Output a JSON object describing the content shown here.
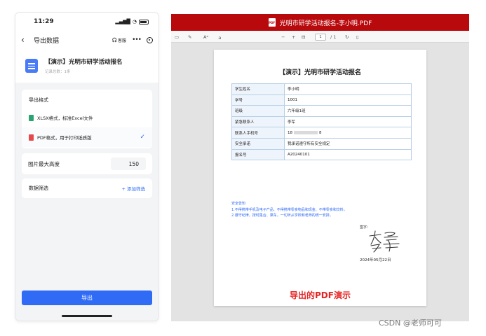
{
  "phone": {
    "time": "11:29",
    "nav": {
      "back_icon": "chevron-left-icon",
      "title": "导出数据",
      "service": "客服"
    },
    "document": {
      "icon": "document-icon",
      "title": "【演示】光明市研学活动报名",
      "subtitle": "记录总数：1条"
    },
    "format": {
      "label": "导出格式",
      "options": [
        {
          "icon": "xlsx-file-icon",
          "color": "#2ba471",
          "text": "XLSX格式，标准Excel文件",
          "selected": false
        },
        {
          "icon": "pdf-file-icon",
          "color": "#e5484d",
          "text": "PDF格式，用于打印纸质版",
          "selected": true
        }
      ]
    },
    "image_height": {
      "label": "图片最大高度",
      "value": "150"
    },
    "filter": {
      "label": "数据筛选",
      "add": "+ 添加筛选"
    },
    "export_button": "导出",
    "accent": "#2f6bf5"
  },
  "viewer": {
    "title": "光明市研学活动报名-李小明.PDF",
    "title_bar_color": "#b8090d",
    "toolbar": {
      "minus": "−",
      "plus": "+",
      "page": "1",
      "total": "/ 1"
    },
    "page": {
      "title": "【演示】光明市研学活动报名",
      "rows": [
        {
          "key": "学生姓名",
          "value": "李小明"
        },
        {
          "key": "学号",
          "value": "1001"
        },
        {
          "key": "班级",
          "value": "六年级1班"
        },
        {
          "key": "紧急联系人",
          "value": "李军"
        },
        {
          "key": "联系人手机号",
          "value_start": "18",
          "value_end": "8"
        },
        {
          "key": "安全承诺",
          "value": "我承诺遵守所有安全规定"
        },
        {
          "key": "报名号",
          "value": "A20240101"
        }
      ],
      "notice": [
        "安全告知",
        "1.不得携带手机及电子产品、不得携带零食物品和现金、不带零食和饮料。",
        "2.遵守纪律，按时集合、乘车，一切听从学校和老师的统一安排。"
      ],
      "signature_label": "签字：",
      "signature": "李军",
      "date": "2024年05月22日"
    },
    "demo_label": "导出的PDF演示"
  },
  "watermark": "CSDN @老师可可"
}
